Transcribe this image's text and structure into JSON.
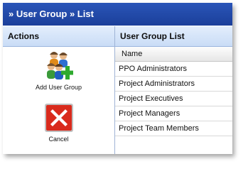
{
  "window": {
    "breadcrumb": "» User Group » List"
  },
  "actions": {
    "header": "Actions",
    "items": [
      {
        "label": "Add User Group",
        "icon": "add-user-group-icon"
      },
      {
        "label": "Cancel",
        "icon": "cancel-icon"
      }
    ]
  },
  "user_group_list": {
    "header": "User Group List",
    "column_header": "Name",
    "rows": [
      "PPO Administrators",
      "Project Administrators",
      "Project Executives",
      "Project Managers",
      "Project Team Members"
    ]
  },
  "colors": {
    "title_bar": "#1f4aa8",
    "panel_header": "#d6e6fb",
    "cancel_red": "#d92a1c"
  }
}
